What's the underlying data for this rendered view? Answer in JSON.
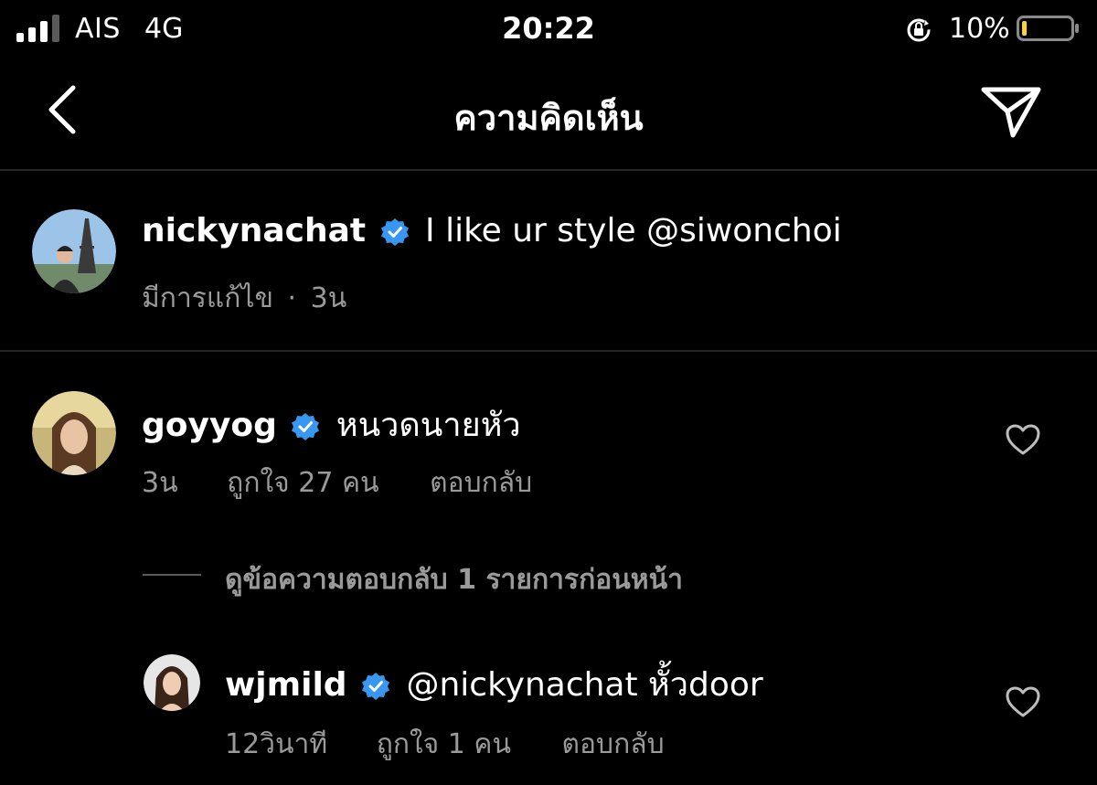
{
  "status_bar": {
    "carrier": "AIS",
    "network": "4G",
    "time": "20:22",
    "battery": "10%",
    "battery_level": 0.1
  },
  "header": {
    "title": "ความคิดเห็น",
    "back_icon": "chevron-left-icon",
    "send_icon": "paper-plane-icon"
  },
  "caption": {
    "username": "nickynachat",
    "text": "I like ur style @siwonchoi",
    "edited": "มีการแก้ไข",
    "separator": "·",
    "time": "3น"
  },
  "comments": [
    {
      "username": "goyyog",
      "text": "หนวดนายหัว",
      "time": "3น",
      "likes": "ถูกใจ 27 คน",
      "reply": "ตอบกลับ"
    }
  ],
  "view_replies": "ดูข้อความตอบกลับ 1 รายการก่อนหน้า",
  "replies": [
    {
      "username": "wjmild",
      "text": "@nickynachat หั้วdoor",
      "time": "12วินาที",
      "likes": "ถูกใจ 1 คน",
      "reply": "ตอบกลับ"
    }
  ],
  "colors": {
    "background": "#000000",
    "text": "#ffffff",
    "secondary": "#9a9a9a",
    "verified": "#3897f0",
    "divider": "#262626",
    "battery_low": "#f5d33b"
  }
}
